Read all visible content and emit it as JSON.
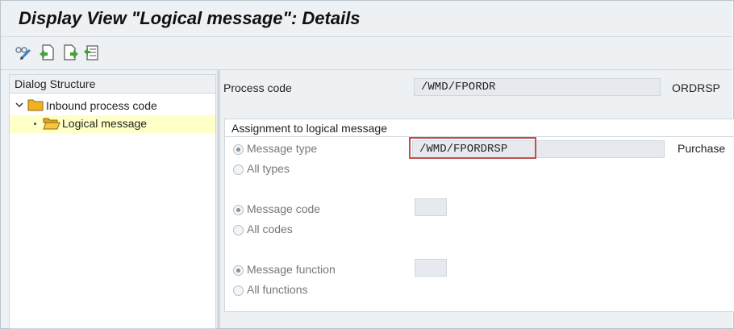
{
  "window": {
    "title": "Display View \"Logical message\": Details"
  },
  "toolbar": {
    "buttons": [
      {
        "icon": "display-change-icon"
      },
      {
        "icon": "previous-entry-icon"
      },
      {
        "icon": "next-entry-icon"
      },
      {
        "icon": "select-all-icon"
      }
    ]
  },
  "dialog_structure": {
    "header": "Dialog Structure",
    "items": [
      {
        "label": "Inbound process code",
        "expanded": true,
        "selected": false
      },
      {
        "label": "Logical message",
        "selected": true
      }
    ]
  },
  "details": {
    "process_code_label": "Process code",
    "process_code_value": "/WMD/FPORDR",
    "process_code_desc": "ORDRSP",
    "assignment_title": "Assignment to logical message",
    "message_type_option": "Message type",
    "message_type_value": "/WMD/FPORDRSP",
    "message_type_desc": "Purchase",
    "all_types_option": "All types",
    "message_code_option": "Message code",
    "message_code_value": "",
    "all_codes_option": "All codes",
    "message_function_option": "Message function",
    "message_function_value": "",
    "all_functions_option": "All functions"
  },
  "colors": {
    "background": "#eef1f4",
    "selected_row": "#ffffc8",
    "folder": "#f2b21f",
    "highlight_border": "#c0504d"
  }
}
